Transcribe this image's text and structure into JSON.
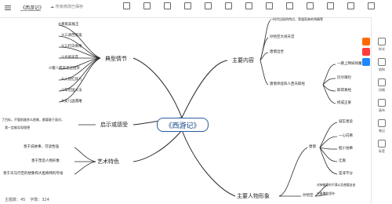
{
  "toolbar": {
    "doc_title": "《西游记》",
    "save_status": "所有修改已保存"
  },
  "center": {
    "label": "《西游记》"
  },
  "branches": {
    "plot": "典型情节",
    "inspiration": "启示或感受",
    "art": "艺术特色",
    "content": "主要内容",
    "characters": "主要人物形象"
  },
  "plot_items": [
    "④真假美猴王",
    "③三调芭蕉扇",
    "②三打白骨精",
    "①大闹天宫",
    "⑤猪八戒高老庄招亲",
    "⑥火烧红孩儿",
    "⑦车迟国斗法",
    "⑧女儿国遇难"
  ],
  "inspiration_items": [
    "了目标，不管前路多么困难，都要敢于面对，",
    "我一定能实现理想"
  ],
  "art_items": [
    "善于说故事，可读性强",
    "善于塑造人物形象",
    "善于天马行空的想象和大胆奇特的夸张"
  ],
  "content_items": [
    "一时代出现的特点，背道而来的鸡精等",
    "孙悟空大闹天宫",
    "唐僧出世",
    "唐僧师徒四人西天取经",
    "一路上降妖除魔",
    "历尽艰险",
    "取得真经",
    "修成正果"
  ],
  "character_items": {
    "tang": "唐僧",
    "sun": "孙悟空",
    "tang_traits": [
      "诚实善良",
      "一心向佛",
      "胆小怕事",
      "迂腐",
      "是非不分"
    ],
    "sun_traits": [
      "对神佛界的不满以及想要自由",
      "对唐僧的坚持"
    ]
  },
  "statusbar": {
    "topic_count": "主题数：45",
    "word_count": "字数：324"
  },
  "sidepanel": {
    "items": [
      "样式",
      "结构",
      "风格",
      "画布",
      "笔记",
      "标签"
    ]
  },
  "colors": {
    "line": "#2a2a2a",
    "center_border": "#2b5d9e",
    "center_text": "#0e3f85"
  }
}
